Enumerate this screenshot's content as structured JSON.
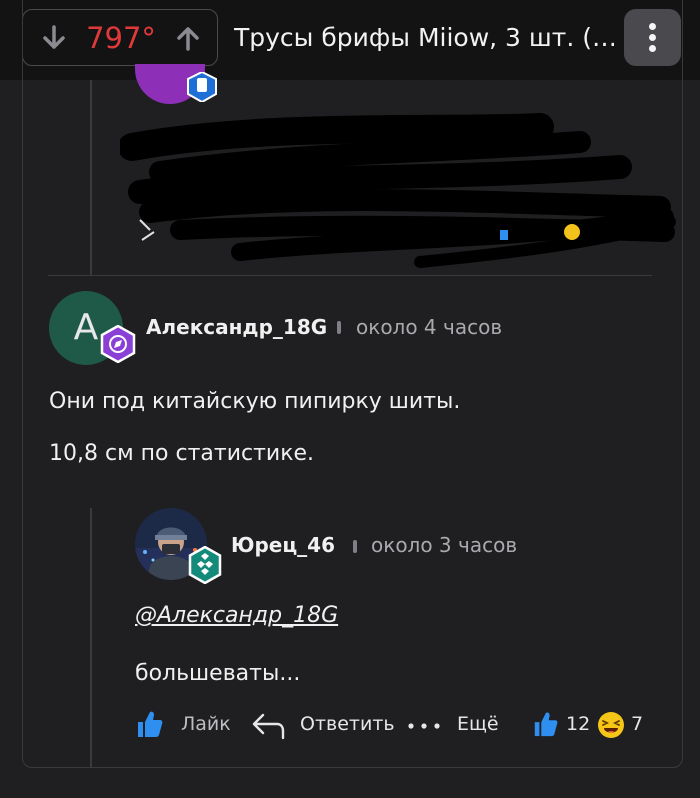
{
  "header": {
    "vote_score": "797°",
    "post_title": "Трусы брифы Miiow, 3 шт. (…"
  },
  "comments": [
    {
      "avatar_letter": "А",
      "username": "Александр_18G",
      "time": "около 4 часов",
      "lines": [
        "Они под китайскую пипирку шиты.",
        "10,8 см по статистике."
      ]
    },
    {
      "username": "Юрец_46",
      "time": "около 3 часов",
      "mention": "@Александр_18G",
      "text": "большеваты...",
      "actions": {
        "like_label": "Лайк",
        "reply_label": "Ответить",
        "more_label": "Ещё",
        "likes_count": "12",
        "laugh_count": "7"
      }
    }
  ],
  "colors": {
    "background": "#1f1f21",
    "score": "#e03939",
    "accent_blue": "#2f8ff0"
  },
  "icons": [
    "arrow-down-icon",
    "arrow-up-icon",
    "more-vertical-icon",
    "compass-badge-icon",
    "diamond-badge-icon",
    "thumbs-up-icon",
    "reply-arrow-icon",
    "ellipsis-icon",
    "laughing-emoji-icon"
  ]
}
